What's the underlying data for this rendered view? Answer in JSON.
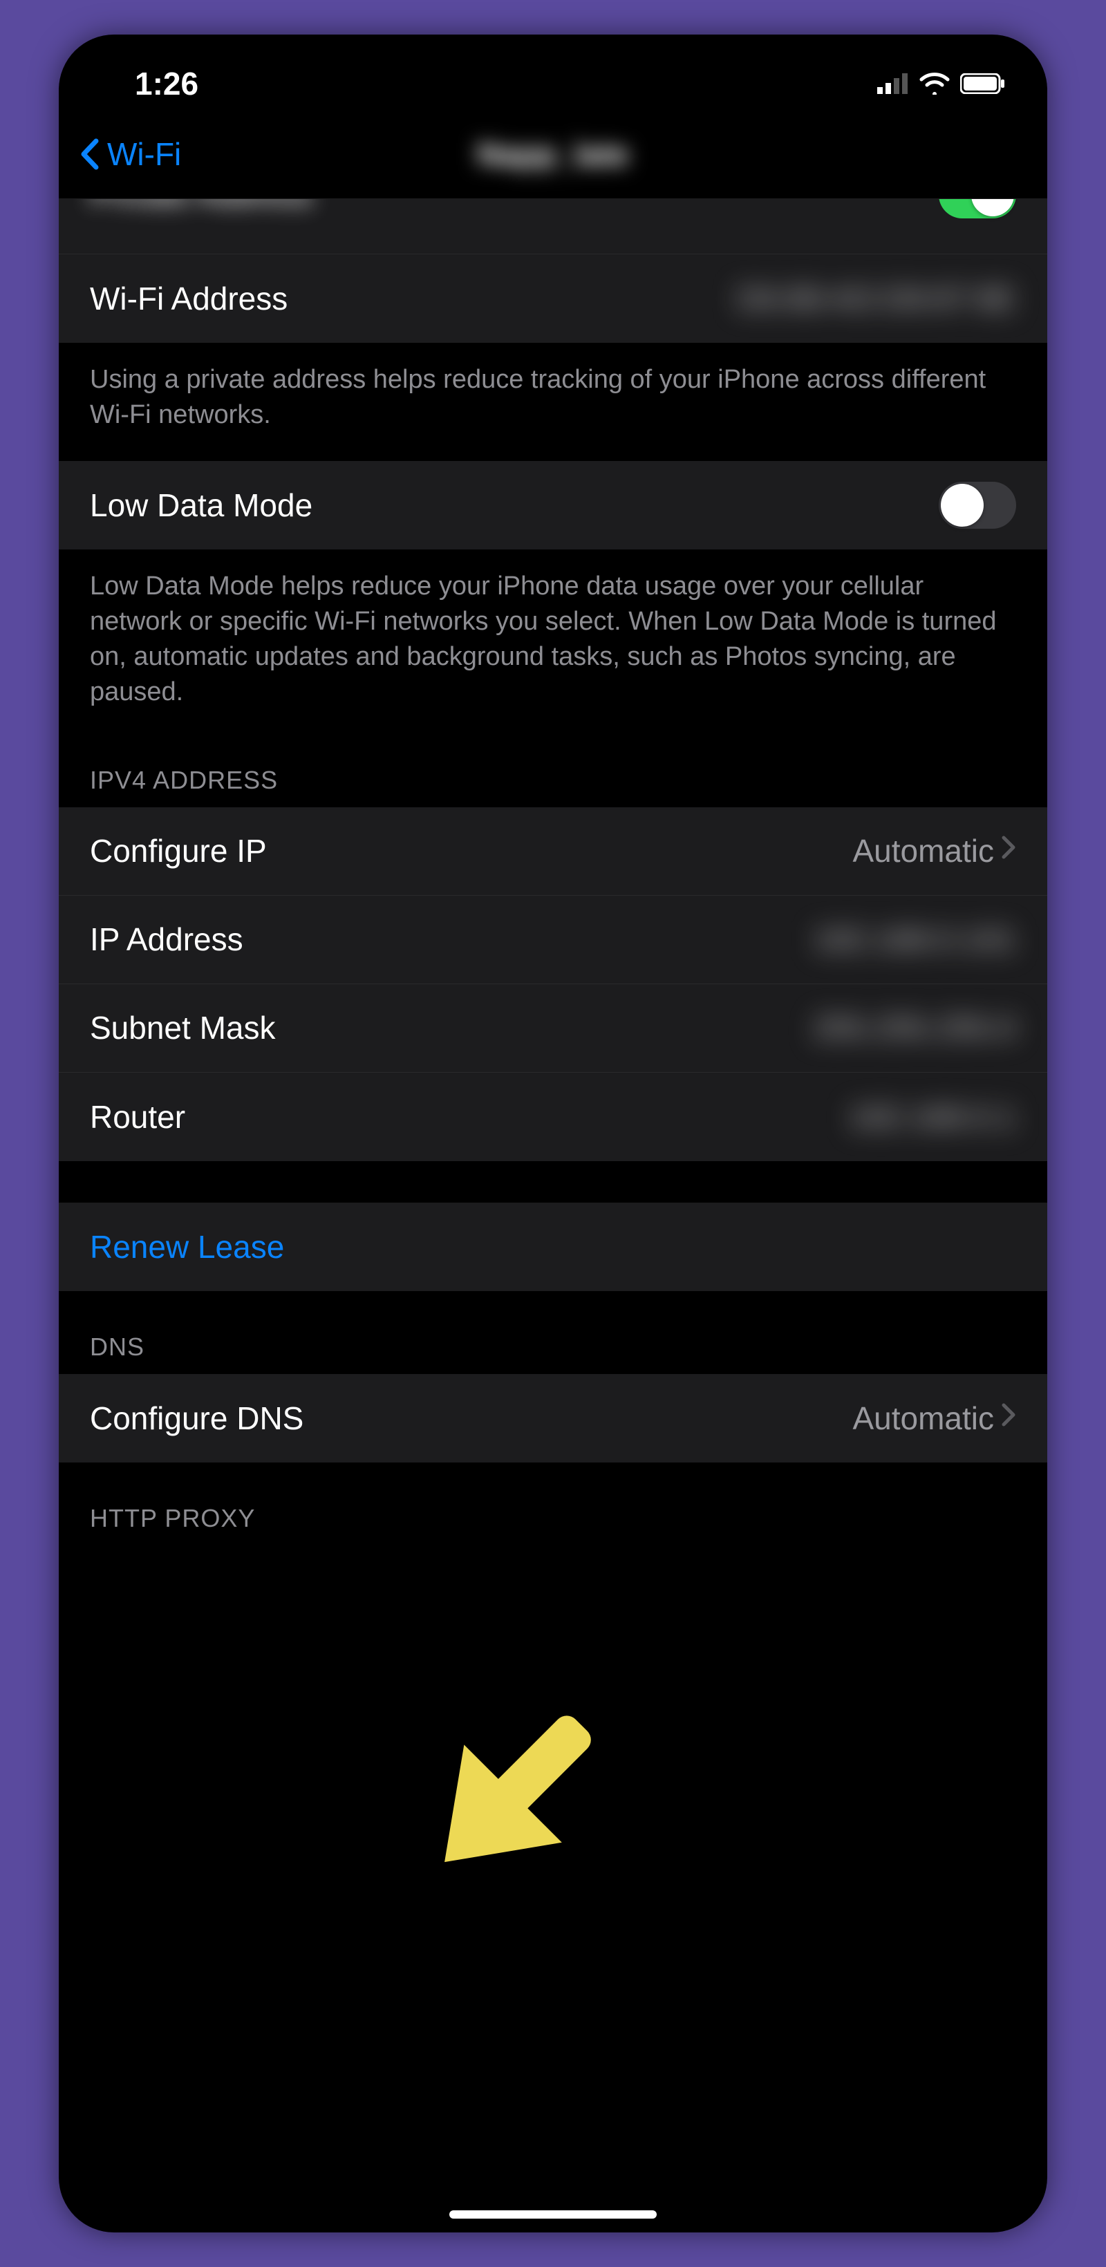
{
  "statusbar": {
    "time": "1:26"
  },
  "nav": {
    "back_label": "Wi-Fi",
    "title_blurred": "Napp_late"
  },
  "rows": {
    "private_address": {
      "label": "Private Address"
    },
    "wifi_address": {
      "label": "Wi-Fi Address",
      "value_blurred": "D6:88:AD:D8:87:8E"
    },
    "private_footer": "Using a private address helps reduce tracking of your iPhone across different Wi-Fi networks.",
    "low_data": {
      "label": "Low Data Mode"
    },
    "low_data_footer": "Low Data Mode helps reduce your iPhone data usage over your cellular network or specific Wi-Fi networks you select. When Low Data Mode is turned on, automatic updates and background tasks, such as Photos syncing, are paused.",
    "ipv4_header": "IPV4 ADDRESS",
    "configure_ip": {
      "label": "Configure IP",
      "value": "Automatic"
    },
    "ip_address": {
      "label": "IP Address",
      "value_blurred": "192.168.0.101"
    },
    "subnet_mask": {
      "label": "Subnet Mask",
      "value_blurred": "255.255.255.0"
    },
    "router": {
      "label": "Router",
      "value_blurred": "192.168.0.1"
    },
    "renew_lease": {
      "label": "Renew Lease"
    },
    "dns_header": "DNS",
    "configure_dns": {
      "label": "Configure DNS",
      "value": "Automatic"
    },
    "http_proxy_header": "HTTP PROXY"
  }
}
